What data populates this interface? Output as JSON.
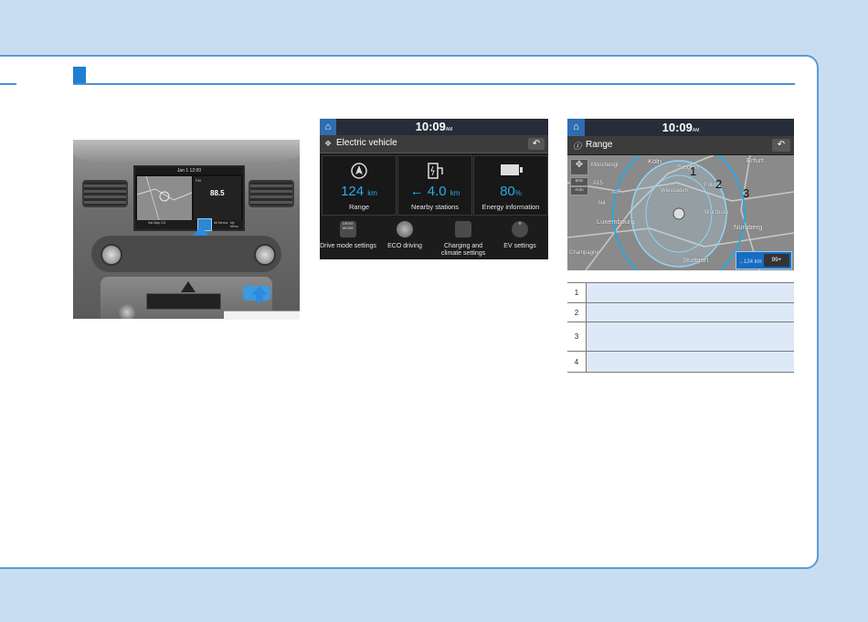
{
  "colors": {
    "page_bg": "#c9ddf2",
    "accent": "#1e7fd0",
    "value_blue": "#2aaae8",
    "legend_fill": "#dde9f6"
  },
  "photo": {
    "clock": "Jan 1 12:00",
    "freq": "88.5",
    "band": "FM",
    "tabs": [
      "Sat Map GO",
      "All Menus",
      "My Menu"
    ]
  },
  "ev_screen": {
    "time": "10:09",
    "ampm": "AM",
    "title": "Electric vehicle",
    "home_icon": "home-icon",
    "back_icon": "back-arrow-icon",
    "tiles": [
      {
        "value": "124",
        "unit": "km",
        "label": "Range",
        "icon": "compass-arrow-icon"
      },
      {
        "value": "← 4.0",
        "unit": "km",
        "label": "Nearby stations",
        "icon": "charging-station-icon"
      },
      {
        "value": "80",
        "unit": "%",
        "label": "Energy information",
        "icon": "battery-icon"
      }
    ],
    "submenu": [
      {
        "label": "Drive mode settings",
        "icon_text": "DRIVE MODE"
      },
      {
        "label": "ECO driving",
        "icon_text": ""
      },
      {
        "label": "Charging and climate settings",
        "icon_text": ""
      },
      {
        "label": "EV settings",
        "icon_text": ""
      }
    ]
  },
  "range_screen": {
    "time": "10:09",
    "ampm": "AM",
    "title": "Range",
    "map_labels": [
      "Köln",
      "Siegen",
      "Erfurt",
      "Luxembourg",
      "Nürnberg",
      "Stuttgart",
      "Wiesbaden",
      "Würzburg",
      "Champagne",
      "Mönchengl.",
      "Fulda"
    ],
    "road_labels": [
      "A15",
      "A27",
      "N4"
    ],
    "markers": [
      "1",
      "2",
      "3"
    ],
    "scale": "50m",
    "auto": "Auto",
    "range_chip": "→124 km",
    "poi_chip": "99+"
  },
  "legend": {
    "rows": [
      {
        "num": "1",
        "text": ""
      },
      {
        "num": "2",
        "text": ""
      },
      {
        "num": "3",
        "text": ""
      },
      {
        "num": "4",
        "text": ""
      }
    ]
  }
}
